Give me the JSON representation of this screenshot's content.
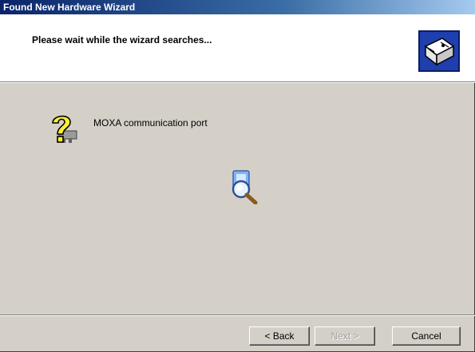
{
  "window": {
    "title": "Found New Hardware Wizard"
  },
  "header": {
    "title": "Please wait while the wizard searches...",
    "icon": "hardware-wizard-icon"
  },
  "main": {
    "device_icon": "question-mark-hardware-icon",
    "device_name": "MOXA communication port",
    "search_animation_icon": "magnifier-search-icon"
  },
  "footer": {
    "back_label": "< Back",
    "next_label": "Next >",
    "cancel_label": "Cancel",
    "next_enabled": false
  },
  "colors": {
    "titlebar_start": "#0a246a",
    "titlebar_end": "#a6caf0",
    "dialog_face": "#d4d0c8",
    "header_bg": "#ffffff"
  }
}
